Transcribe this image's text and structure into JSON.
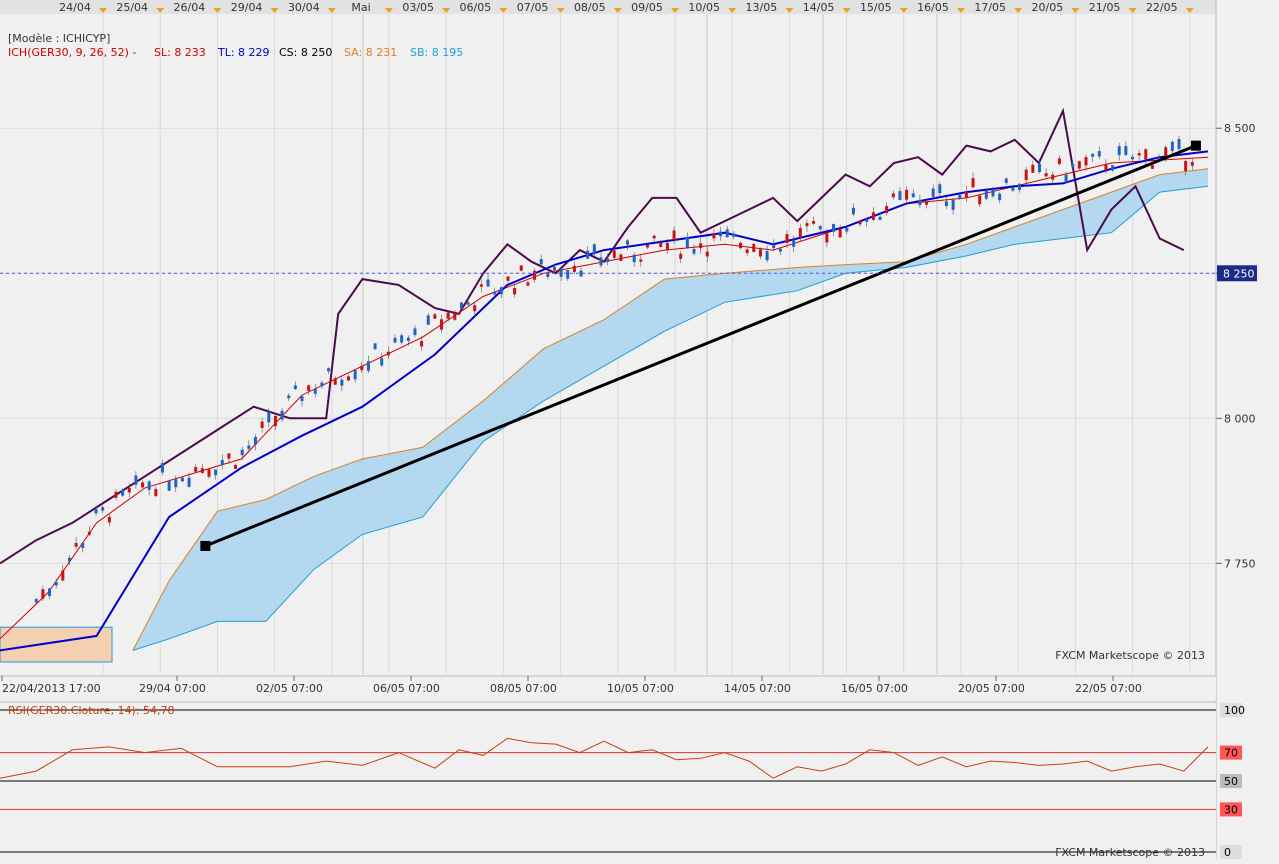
{
  "top_dates": [
    "24/04",
    "25/04",
    "26/04",
    "29/04",
    "30/04",
    "Mai",
    "03/05",
    "06/05",
    "07/05",
    "08/05",
    "09/05",
    "10/05",
    "13/05",
    "14/05",
    "15/05",
    "16/05",
    "17/05",
    "20/05",
    "21/05",
    "22/05"
  ],
  "indicator_legend": {
    "template": "[Modèle : ICHICYP]",
    "name": "ICH(GER30, 9, 26, 52) -",
    "sl": "SL: 8 233",
    "tl": "TL: 8 229",
    "cs": "CS: 8 250",
    "sa": "SA: 8 231",
    "sb": "SB: 8 195"
  },
  "colors": {
    "sl": "#cc0000",
    "tl": "#0000cc",
    "cs": "#000000",
    "sa": "#e08020",
    "sb": "#1ba0d8",
    "chikou": "#4b0a4b",
    "cloud": "#a8d4ee",
    "cloud_bear": "#f4d0b0",
    "candle_up": "#1e64c8",
    "candle_down": "#cc1111",
    "rsi_line": "#c84010",
    "trendline": "#000000"
  },
  "price_axis": {
    "ticks": [
      "8 500",
      "8 250",
      "8 000",
      "7 750"
    ],
    "current_label": "8 250"
  },
  "watermark_main": "FXCM Marketscope © 2013",
  "watermark_rsi": "FXCM Marketscope © 2013",
  "time_axis": [
    "22/04/2013 17:00",
    "29/04 07:00",
    "02/05 07:00",
    "06/05 07:00",
    "08/05 07:00",
    "10/05 07:00",
    "14/05 07:00",
    "16/05 07:00",
    "20/05 07:00",
    "22/05 07:00"
  ],
  "rsi_legend": "RSI(GER30.Cloture, 14): 54,78",
  "rsi_axis": [
    "100",
    "70",
    "50",
    "30",
    "0"
  ],
  "chart_data": {
    "type": "line",
    "title": "",
    "symbol": "GER30",
    "ylim": [
      7580,
      8690
    ],
    "current_level": 8250,
    "series": [
      {
        "name": "TL",
        "style": "line",
        "x": [
          0,
          8,
          14,
          20,
          25,
          30,
          36,
          42,
          46,
          50,
          55,
          60,
          64,
          70,
          75,
          80,
          84,
          88,
          92,
          96,
          100
        ],
        "values": [
          7600,
          7625,
          7830,
          7915,
          7970,
          8020,
          8110,
          8230,
          8265,
          8290,
          8305,
          8320,
          8300,
          8330,
          8370,
          8390,
          8400,
          8405,
          8430,
          8450,
          8460
        ]
      },
      {
        "name": "SL",
        "style": "line",
        "x": [
          0,
          4,
          8,
          12,
          16,
          20,
          25,
          30,
          35,
          40,
          45,
          50,
          55,
          60,
          64,
          70,
          75,
          80,
          84,
          88,
          92,
          96,
          100
        ],
        "values": [
          7620,
          7700,
          7820,
          7880,
          7905,
          7930,
          8040,
          8090,
          8140,
          8210,
          8250,
          8270,
          8290,
          8300,
          8290,
          8330,
          8370,
          8380,
          8400,
          8420,
          8440,
          8445,
          8450
        ]
      },
      {
        "name": "SA",
        "style": "line",
        "x": [
          11,
          14,
          18,
          22,
          26,
          30,
          35,
          40,
          45,
          50,
          55,
          60,
          66,
          70,
          75,
          80,
          84,
          88,
          92,
          96,
          100
        ],
        "values": [
          7600,
          7720,
          7840,
          7860,
          7900,
          7930,
          7950,
          8030,
          8120,
          8170,
          8240,
          8250,
          8260,
          8265,
          8270,
          8300,
          8330,
          8360,
          8390,
          8420,
          8430
        ]
      },
      {
        "name": "SB",
        "style": "line",
        "x": [
          11,
          14,
          18,
          22,
          26,
          30,
          35,
          40,
          45,
          50,
          55,
          60,
          66,
          70,
          75,
          80,
          84,
          88,
          92,
          96,
          100
        ],
        "values": [
          7600,
          7620,
          7650,
          7650,
          7740,
          7800,
          7830,
          7960,
          8030,
          8090,
          8150,
          8200,
          8220,
          8250,
          8260,
          8280,
          8300,
          8310,
          8320,
          8390,
          8400
        ]
      },
      {
        "name": "CS",
        "style": "chikou",
        "x": [
          0,
          3,
          6,
          9,
          12,
          15,
          18,
          21,
          24,
          27,
          28,
          30,
          33,
          36,
          38,
          40,
          42,
          44,
          46,
          48,
          50,
          52,
          54,
          56,
          58,
          60,
          62,
          64,
          66,
          68,
          70,
          72,
          74,
          76,
          78,
          80,
          82,
          84,
          86,
          88,
          90,
          92,
          94,
          96,
          97,
          98
        ],
        "values": [
          7750,
          7790,
          7820,
          7860,
          7900,
          7940,
          7980,
          8020,
          8000,
          8000,
          8180,
          8240,
          8230,
          8190,
          8180,
          8250,
          8300,
          8270,
          8250,
          8290,
          8270,
          8330,
          8380,
          8380,
          8320,
          8340,
          8360,
          8380,
          8340,
          8380,
          8420,
          8400,
          8440,
          8450,
          8420,
          8470,
          8460,
          8480,
          8440,
          8530,
          8290,
          8360,
          8400,
          8310,
          8300,
          8290
        ]
      },
      {
        "name": "Trend",
        "style": "trendline",
        "x": [
          17,
          99
        ],
        "values": [
          7780,
          8470
        ]
      }
    ],
    "rsi": {
      "name": "RSI(GER30.Cloture, 14)",
      "last": 54.78,
      "ylim": [
        0,
        100
      ],
      "levels": [
        70,
        50,
        30
      ],
      "x": [
        0,
        3,
        6,
        9,
        12,
        15,
        18,
        21,
        24,
        27,
        30,
        33,
        36,
        38,
        40,
        42,
        44,
        46,
        48,
        50,
        52,
        54,
        56,
        58,
        60,
        62,
        64,
        66,
        68,
        70,
        72,
        74,
        76,
        78,
        80,
        82,
        84,
        86,
        88,
        90,
        92,
        94,
        96,
        98,
        100
      ],
      "values": [
        52,
        57,
        72,
        74,
        70,
        73,
        60,
        60,
        60,
        64,
        61,
        70,
        59,
        72,
        68,
        80,
        77,
        76,
        70,
        78,
        70,
        72,
        65,
        66,
        70,
        64,
        52,
        60,
        57,
        62,
        72,
        70,
        61,
        67,
        60,
        64,
        63,
        61,
        62,
        64,
        57,
        60,
        62,
        57,
        74
      ]
    }
  }
}
